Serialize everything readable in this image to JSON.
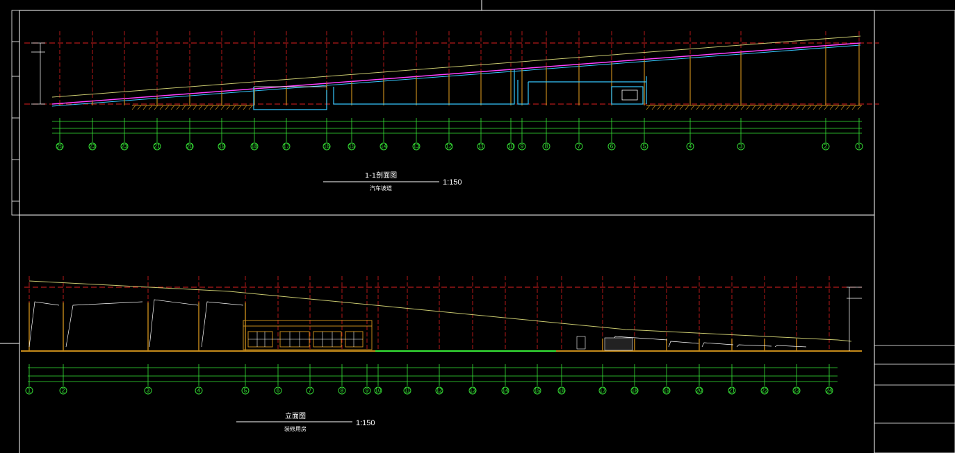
{
  "section": {
    "title": "1-1剖面图",
    "scale": "1:150",
    "subtitle": "汽车坡道",
    "axes": [
      "25",
      "23",
      "23",
      "21",
      "20",
      "19",
      "18",
      "17",
      "16",
      "15",
      "14",
      "13",
      "12",
      "11",
      "10",
      "9",
      "8",
      "7",
      "6",
      "5",
      "4",
      "3",
      "2",
      "1"
    ]
  },
  "elevation": {
    "title": "立面图",
    "scale": "1:150",
    "subtitle": "装修用房",
    "axes": [
      "1",
      "2",
      "3",
      "4",
      "5",
      "6",
      "7",
      "8",
      "9",
      "10",
      "11",
      "12",
      "13",
      "14",
      "15",
      "16",
      "17",
      "18",
      "19",
      "20",
      "21",
      "22",
      "23",
      "24"
    ]
  },
  "colors": {
    "background": "#000000",
    "structure": "#c58a1a",
    "grid": "#e02020",
    "dimension": "#37e837",
    "slab": "#ff40ff",
    "slab2": "#35c8ff",
    "roof": "#c8c86e",
    "frame": "#ffffff"
  }
}
